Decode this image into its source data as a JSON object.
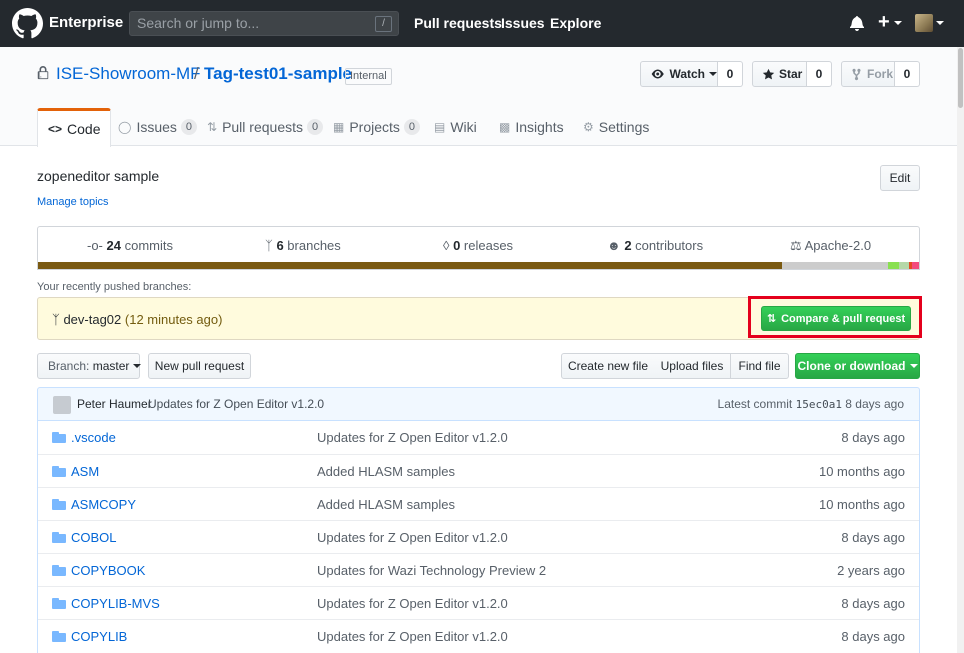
{
  "header": {
    "brand": "Enterprise",
    "search_placeholder": "Search or jump to...",
    "search_key": "/",
    "nav": [
      "Pull requests",
      "Issues",
      "Explore"
    ],
    "plus": "+"
  },
  "repo": {
    "owner": "ISE-Showroom-MF",
    "separator": "/",
    "name": "Tag-test01-sample",
    "visibility": "Internal",
    "watch_label": "Watch",
    "watch_count": "0",
    "star_label": "Star",
    "star_count": "0",
    "fork_label": "Fork",
    "fork_count": "0"
  },
  "tabs": [
    {
      "label": "Code",
      "icon": "code-icon",
      "count": ""
    },
    {
      "label": "Issues",
      "icon": "issue-icon",
      "count": "0"
    },
    {
      "label": "Pull requests",
      "icon": "pull-request-icon",
      "count": "0"
    },
    {
      "label": "Projects",
      "icon": "project-icon",
      "count": "0"
    },
    {
      "label": "Wiki",
      "icon": "book-icon",
      "count": ""
    },
    {
      "label": "Insights",
      "icon": "graph-icon",
      "count": ""
    },
    {
      "label": "Settings",
      "icon": "gear-icon",
      "count": ""
    }
  ],
  "description": {
    "text": "zopeneditor sample",
    "manage_topics": "Manage topics",
    "edit_label": "Edit"
  },
  "summary": {
    "commits_count": "24",
    "commits_label": "commits",
    "branches_count": "6",
    "branches_label": "branches",
    "releases_count": "0",
    "releases_label": "releases",
    "contributors_count": "2",
    "contributors_label": "contributors",
    "license": "Apache-2.0"
  },
  "language_bar": {
    "segments": [
      {
        "color": "#7a5a12",
        "fraction": 0.845
      },
      {
        "color": "#cccccc",
        "fraction": 0.12
      },
      {
        "color": "#89e051",
        "fraction": 0.012
      },
      {
        "color": "#b5d8a8",
        "fraction": 0.012
      },
      {
        "color": "#e44b23",
        "fraction": 0.003
      },
      {
        "color": "#f34b7d",
        "fraction": 0.008
      }
    ]
  },
  "recent": {
    "label": "Your recently pushed branches:",
    "branch": "dev-tag02",
    "time": "(12 minutes ago)",
    "compare_label": "Compare & pull request"
  },
  "file_nav": {
    "branch_prefix": "Branch:",
    "branch_name": "master",
    "new_pr": "New pull request",
    "create_file": "Create new file",
    "upload_files": "Upload files",
    "find_file": "Find file",
    "clone": "Clone or download"
  },
  "commit": {
    "author": "Peter Haumer",
    "message": "Updates for Z Open Editor v1.2.0",
    "latest_label": "Latest commit",
    "sha": "15ec0a1",
    "age": "8 days ago"
  },
  "files": [
    {
      "name": ".vscode",
      "message": "Updates for Z Open Editor v1.2.0",
      "age": "8 days ago"
    },
    {
      "name": "ASM",
      "message": "Added HLASM samples",
      "age": "10 months ago"
    },
    {
      "name": "ASMCOPY",
      "message": "Added HLASM samples",
      "age": "10 months ago"
    },
    {
      "name": "COBOL",
      "message": "Updates for Z Open Editor v1.2.0",
      "age": "8 days ago"
    },
    {
      "name": "COPYBOOK",
      "message": "Updates for Wazi Technology Preview 2",
      "age": "2 years ago"
    },
    {
      "name": "COPYLIB-MVS",
      "message": "Updates for Z Open Editor v1.2.0",
      "age": "8 days ago"
    },
    {
      "name": "COPYLIB",
      "message": "Updates for Z Open Editor v1.2.0",
      "age": "8 days ago"
    }
  ],
  "colors": {
    "header_bg": "#24292e",
    "link": "#0366d6",
    "green_button": "#28a745",
    "highlight_box": "#e4001c",
    "tab_accent": "#e36209"
  }
}
